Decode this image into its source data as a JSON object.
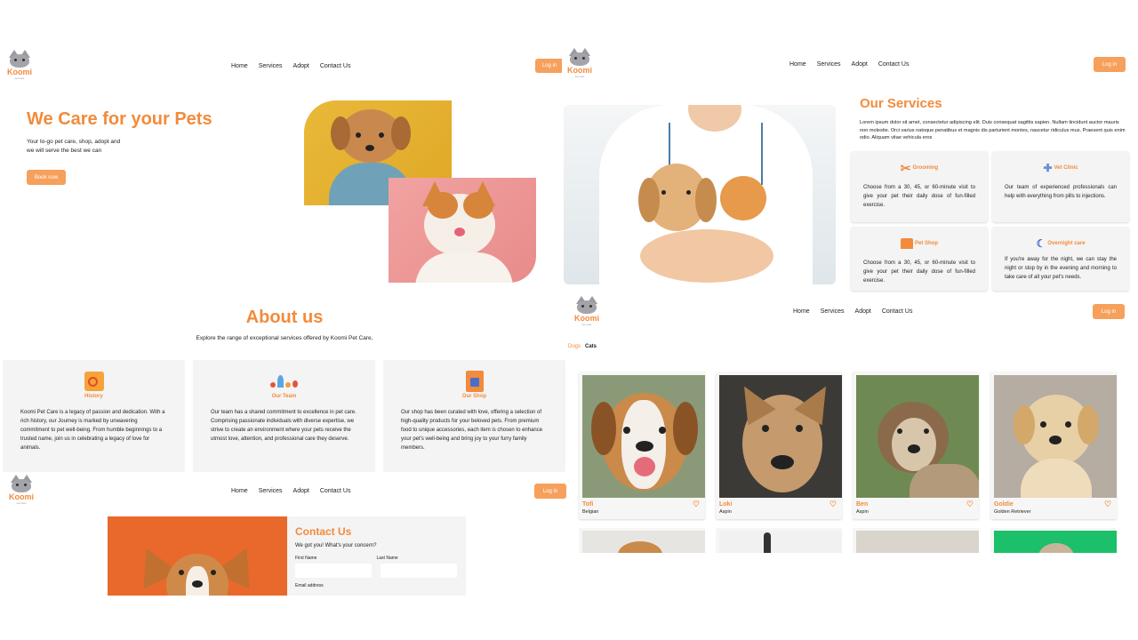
{
  "brand": {
    "name": "Koomi",
    "tagline": "pet care",
    "accent_color": "#f28b3c"
  },
  "nav": {
    "home": "Home",
    "services": "Services",
    "adopt": "Adopt",
    "contact": "Contact Us",
    "login": "Log in"
  },
  "hero": {
    "title": "We Care for your Pets",
    "subtitle_line1": "Your to-go pet care, shop, adopt and",
    "subtitle_line2": "we will serve the best we can",
    "cta": "Book now"
  },
  "services": {
    "title": "Our Services",
    "intro": "Lorem ipsum dolor sit amet, consectetur adipiscing elit. Duis consequat sagittis sapien. Nullam tincidunt auctor mauris non molestie. Orci varius natoque penatibus et magnis dis parturient montes, nascetur ridiculus mus. Praesent quis enim odio. Aliquam vitae vehicula eros",
    "cards": [
      {
        "title": "Grooming",
        "icon": "grooming-icon",
        "text": "Choose from a 30, 45, or 60-minute visit to give your pet their daily dose of fun-filled exercise."
      },
      {
        "title": "Vet Clinic",
        "icon": "vet-clinic-icon",
        "text": "Our team of experienced professionals can help with everything from pills to injections."
      },
      {
        "title": "Pet Shop",
        "icon": "pet-shop-icon",
        "text": "Choose from a 30, 45, or 60-minute visit to give your pet their daily dose of fun-filled exercise."
      },
      {
        "title": "Overnight care",
        "icon": "overnight-care-icon",
        "text": "If you're away for the night, we can stay the night or stop by in the evening and morning to take care of all your pet's needs."
      }
    ]
  },
  "about": {
    "title": "About us",
    "subtitle": "Explore the range of exceptional services offered by Koomi Pet Care,",
    "cards": [
      {
        "title": "History",
        "icon": "history-icon",
        "text": "Koomi Pet Care is a legacy of passion and dedication. With a rich history, our Journey is marked by unwavering commitment to pet well-being. From humble beginnings to a trusted name, join us in celebrating a legacy of love for animals."
      },
      {
        "title": "Our Team",
        "icon": "team-icon",
        "text": "Our team has a shared commitment to excellence in pet care. Comprising passionate individuals with diverse expertise, we strive to create an environment where your pets receive the utmost love, attention, and professional care they deserve."
      },
      {
        "title": "Our Shop",
        "icon": "shop-icon",
        "text": "Our shop has been curated with love, offering a selection of high-quality products for your beloved pets. From premium food to unique accessories, each item is chosen to enhance your pet's well-being and bring joy to your furry family members."
      }
    ]
  },
  "contact": {
    "title": "Contact Us",
    "subtitle": "We got you! What's your concern?",
    "first_name_label": "First Name",
    "last_name_label": "Last Name",
    "email_label": "Email address"
  },
  "adopt": {
    "tabs": [
      {
        "label": "Dogs",
        "active": true
      },
      {
        "label": "Cats",
        "active": false
      }
    ],
    "pets": [
      {
        "name": "Tofi",
        "breed": "Belgian"
      },
      {
        "name": "Loki",
        "breed": "Aspin"
      },
      {
        "name": "Ben",
        "breed": "Aspin"
      },
      {
        "name": "Goldie",
        "breed": "Golden Retriever"
      }
    ]
  }
}
